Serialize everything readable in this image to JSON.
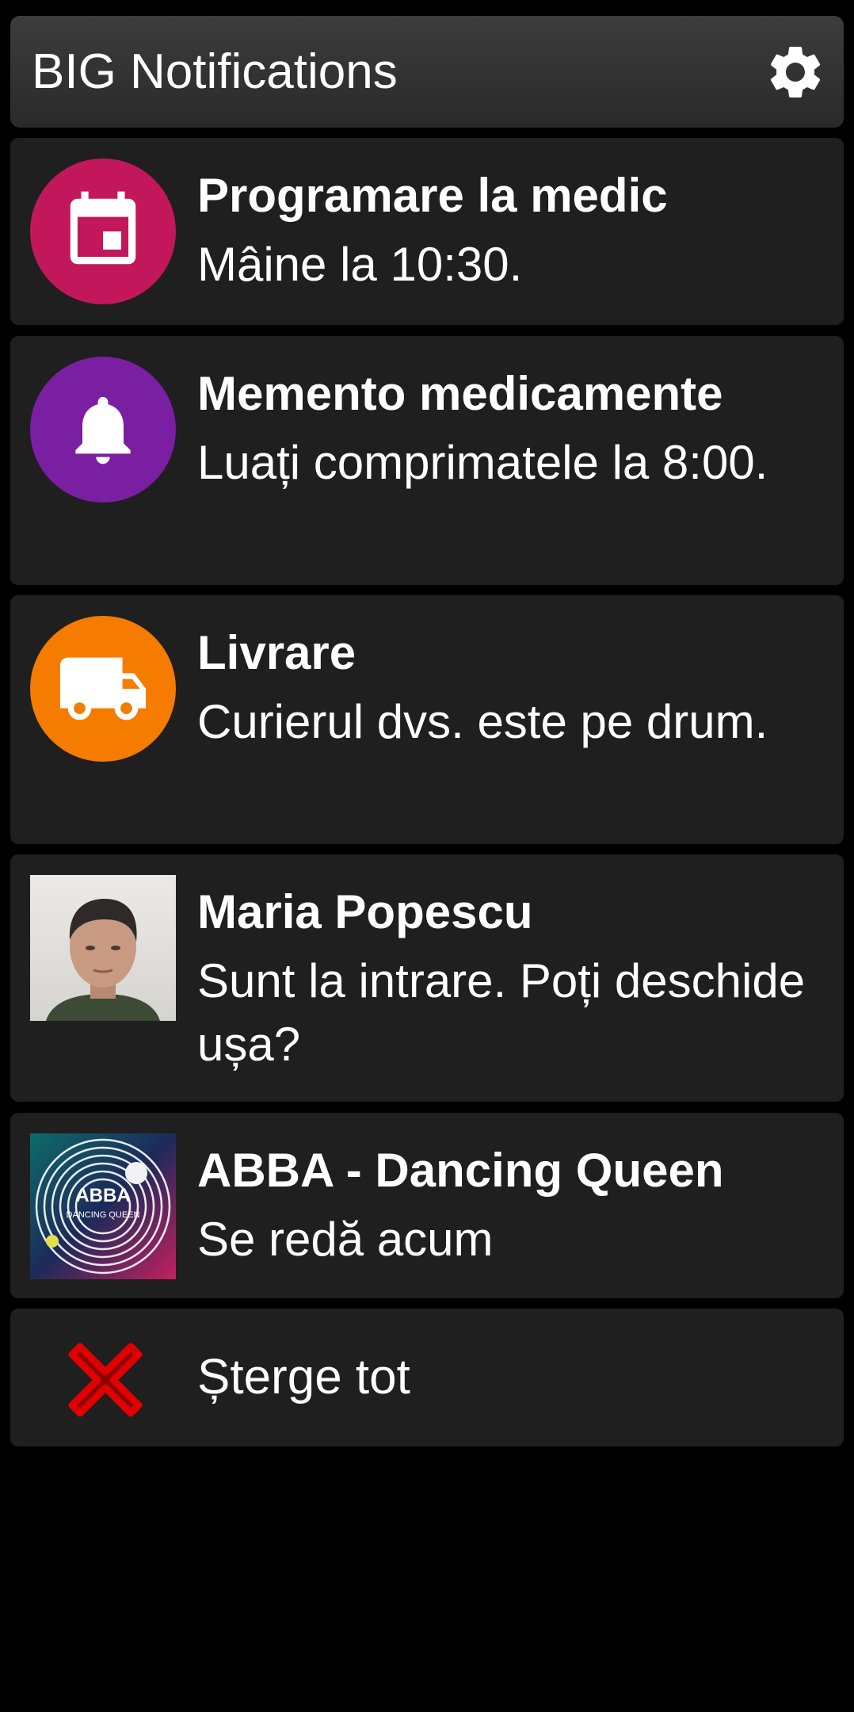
{
  "header": {
    "title": "BIG Notifications",
    "settings_icon": "gear-icon"
  },
  "notifications": [
    {
      "title": "Programare la medic",
      "body": "Mâine la 10:30.",
      "icon": "calendar-icon",
      "color": "#c2185b"
    },
    {
      "title": "Memento medicamente",
      "body": "Luați comprimatele la 8:00.",
      "icon": "bell-icon",
      "color": "#7b1fa2"
    },
    {
      "title": "Livrare",
      "body": "Curierul dvs. este pe drum.",
      "icon": "truck-icon",
      "color": "#f57c00"
    },
    {
      "title": "Maria Popescu",
      "body": "Sunt la intrare. Poți deschide ușa?",
      "icon": "contact-photo"
    },
    {
      "title": "ABBA - Dancing Queen",
      "body": "Se redă acum",
      "icon": "album-art",
      "album_art_text": "ABBA",
      "album_art_subtext": "DANCING QUEEN"
    }
  ],
  "clear_all": {
    "label": "Șterge tot",
    "icon": "close-x-icon",
    "color": "#e00000"
  }
}
